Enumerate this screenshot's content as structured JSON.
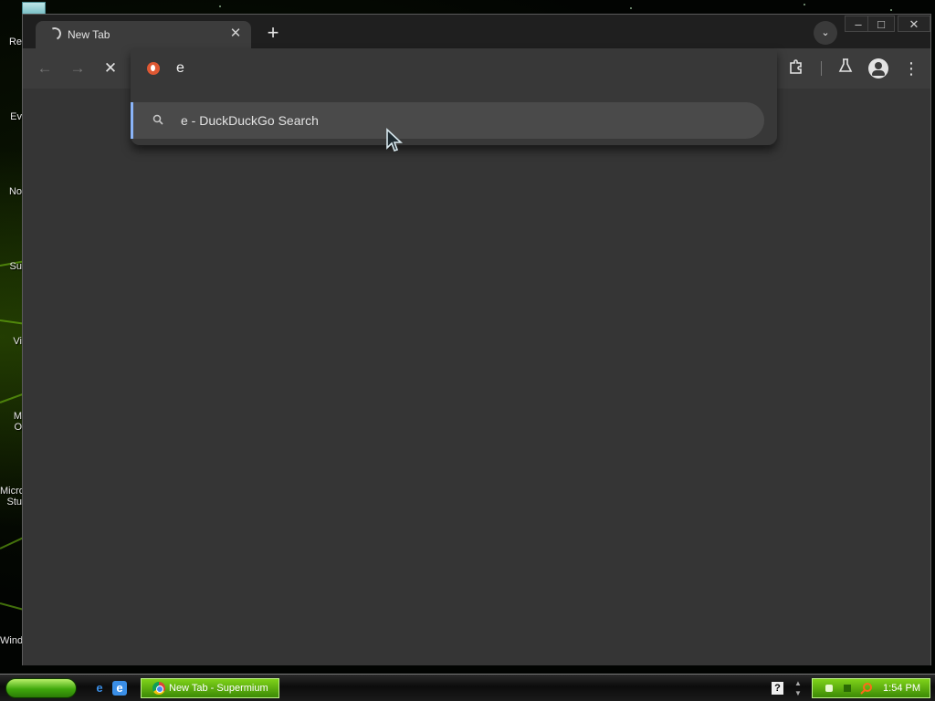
{
  "desktop": {
    "icon_labels": [
      "Re",
      "Ev",
      "No",
      "Su",
      "Vi",
      "M\nO",
      "Micro\nStu",
      "Wind"
    ]
  },
  "browser": {
    "tab": {
      "title": "New Tab",
      "close_icon": "close-icon",
      "status_icon": "loading-spinner-icon"
    },
    "new_tab_icon": "plus-icon",
    "tab_search_icon": "chevron-down-icon",
    "window_controls": {
      "minimize": "minimize-icon",
      "maximize": "maximize-icon",
      "close": "close-icon"
    },
    "toolbar": {
      "back_icon": "arrow-left-icon",
      "forward_icon": "arrow-right-icon",
      "stop_icon": "stop-icon",
      "extensions_icon": "puzzle-icon",
      "labs_icon": "flask-icon",
      "profile_icon": "account-icon",
      "menu_icon": "kebab-menu-icon"
    },
    "omnibox": {
      "favicon": "duckduckgo-icon",
      "value": "e"
    },
    "suggestions": [
      {
        "icon": "search-icon",
        "text": "e - DuckDuckGo Search"
      }
    ]
  },
  "taskbar": {
    "start_button": "start-button",
    "quick_launch": [
      "internet-explorer-icon",
      "internet-explorer-alt-icon"
    ],
    "active_task": {
      "label": "New Tab - Supermium",
      "icon": "supermium-icon"
    },
    "tray": {
      "help_icon": "help-icon",
      "clock": "1:54 PM"
    }
  },
  "colors": {
    "accent": "#8ab4f8",
    "toolbar": "#3c3c3c",
    "content": "#353535",
    "taskbar_green": "#5fb012"
  }
}
